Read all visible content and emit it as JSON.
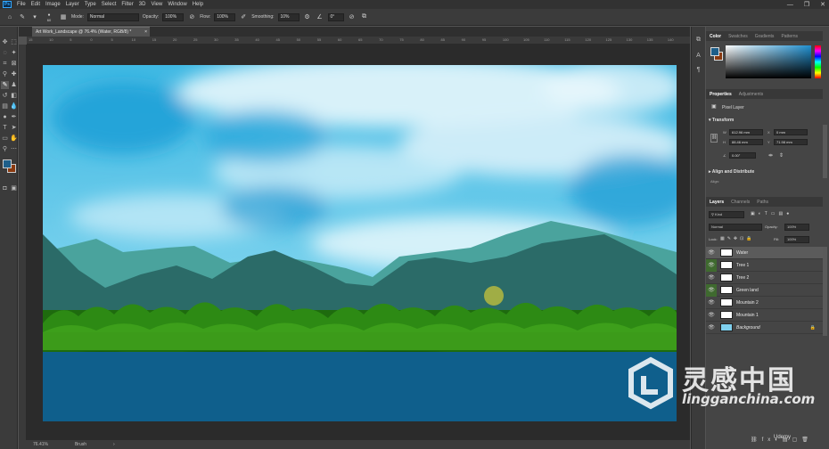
{
  "app": {
    "logo_text": "Ps",
    "menu": [
      "File",
      "Edit",
      "Image",
      "Layer",
      "Type",
      "Select",
      "Filter",
      "3D",
      "View",
      "Window",
      "Help"
    ]
  },
  "options": {
    "mode_label": "Mode:",
    "mode_value": "Normal",
    "opacity_label": "Opacity:",
    "opacity_value": "100%",
    "flow_label": "Flow:",
    "flow_value": "100%",
    "smoothing_label": "Smoothing:",
    "smoothing_value": "10%",
    "angle_value": "0°",
    "brush_size": "60"
  },
  "document": {
    "tab_title": "Art Work_Landscape @ 76.4% (Water, RGB/8) *",
    "zoom": "76.41%",
    "status_info": "Brush"
  },
  "ruler": {
    "top_ticks": [
      "15",
      "10",
      "5",
      "0",
      "5",
      "10",
      "15",
      "20",
      "25",
      "30",
      "35",
      "40",
      "45",
      "50",
      "55",
      "60",
      "65",
      "70",
      "75",
      "80",
      "85",
      "90",
      "95",
      "100",
      "105",
      "110",
      "115",
      "120",
      "125",
      "130",
      "135",
      "140"
    ]
  },
  "color_panel": {
    "tabs": [
      "Color",
      "Swatches",
      "Gradients",
      "Patterns"
    ],
    "fg_color": "#1e5f8a",
    "bg_color": "#8a3a10"
  },
  "properties_panel": {
    "tabs": [
      "Properties",
      "Adjustments"
    ],
    "layer_type": "Pixel Layer",
    "transform_heading": "Transform",
    "w_label": "W",
    "w_value": "612.96 mm",
    "h_label": "H",
    "h_value": "88.46 mm",
    "x_label": "X",
    "x_value": "0 mm",
    "y_label": "Y",
    "y_value": "71.98 mm",
    "angle_value": "0.00°",
    "align_heading": "Align and Distribute",
    "align_label": "Align:"
  },
  "layers_panel": {
    "tabs": [
      "Layers",
      "Channels",
      "Paths"
    ],
    "kind_label": "Kind",
    "blend_mode": "Normal",
    "opacity_label": "Opacity:",
    "opacity_value": "100%",
    "lock_label": "Lock:",
    "fill_label": "Fill:",
    "fill_value": "100%",
    "layers": [
      {
        "name": "Water",
        "selected": true,
        "highlight": false
      },
      {
        "name": "Tree 1",
        "selected": false,
        "highlight": true
      },
      {
        "name": "Tree 2",
        "selected": false,
        "highlight": false
      },
      {
        "name": "Green land",
        "selected": false,
        "highlight": true
      },
      {
        "name": "Mountain 2",
        "selected": false,
        "highlight": false
      },
      {
        "name": "Mountain 1",
        "selected": false,
        "highlight": false
      },
      {
        "name": "Background",
        "selected": false,
        "highlight": false
      }
    ]
  },
  "watermark": {
    "cn": "灵感中国",
    "en": "lingganchina.com"
  },
  "udemy": "Udemy",
  "colors": {
    "ps_dark": "#323232",
    "panel_bg": "#454545",
    "accent_blue": "#31a8ff",
    "water": "#0f5f8c",
    "sky": "#3fb8e3"
  }
}
